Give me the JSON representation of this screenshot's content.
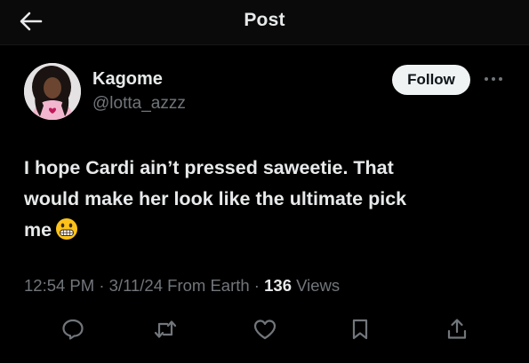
{
  "header": {
    "title": "Post",
    "back_icon": "arrow-left-icon"
  },
  "author": {
    "display_name": "Kagome",
    "handle": "@lotta_azzz",
    "avatar": "avatar-photo"
  },
  "follow_label": "Follow",
  "more_icon": "more-options-icon",
  "tweet": {
    "line1": "I hope Cardi ain’t pressed saweetie. That",
    "line2": "would make her look like the ultimate pick",
    "line3": "me",
    "emoji": "grimacing-face-emoji"
  },
  "meta": {
    "time": "12:54 PM",
    "sep1": " · ",
    "date": "3/11/24",
    "source": " From Earth",
    "sep2": " · ",
    "views_count": "136",
    "views_label": " Views"
  },
  "actions": {
    "reply_icon": "reply-icon",
    "repost_icon": "repost-icon",
    "like_icon": "like-icon",
    "bookmark_icon": "bookmark-icon",
    "share_icon": "share-icon"
  },
  "colors": {
    "background": "#000000",
    "header_bg": "#0a0a0a",
    "text_primary": "#e7e9ea",
    "text_secondary": "#71767b",
    "follow_bg": "#eff3f4",
    "follow_text": "#0f1419"
  }
}
